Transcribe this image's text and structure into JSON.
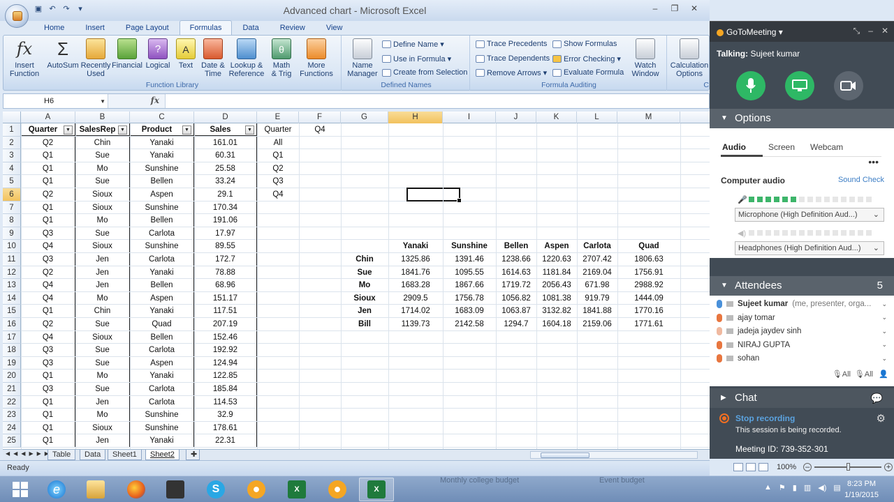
{
  "excel": {
    "title": "Advanced chart - Microsoft Excel",
    "tabs": [
      "Home",
      "Insert",
      "Page Layout",
      "Formulas",
      "Data",
      "Review",
      "View"
    ],
    "active_tab": "Formulas",
    "ribbon": {
      "function_library": {
        "label": "Function Library",
        "insert_function": "Insert\nFunction",
        "autosum": "AutoSum",
        "recently_used": "Recently\nUsed",
        "financial": "Financial",
        "logical": "Logical",
        "text": "Text",
        "date_time": "Date &\nTime",
        "lookup": "Lookup &\nReference",
        "math": "Math\n& Trig",
        "more": "More\nFunctions"
      },
      "defined_names": {
        "label": "Defined Names",
        "name_manager": "Name\nManager",
        "define_name": "Define Name",
        "use_in_formula": "Use in Formula",
        "create_from_selection": "Create from Selection"
      },
      "formula_auditing": {
        "label": "Formula Auditing",
        "trace_precedents": "Trace Precedents",
        "trace_dependents": "Trace Dependents",
        "remove_arrows": "Remove Arrows",
        "show_formulas": "Show Formulas",
        "error_checking": "Error Checking",
        "evaluate_formula": "Evaluate Formula",
        "watch_window": "Watch\nWindow"
      },
      "calculation": {
        "calc_options": "Calculation\nOptions",
        "label": "C"
      }
    },
    "name_box": "H6",
    "fx_symbol": "fx",
    "columns": [
      "A",
      "B",
      "C",
      "D",
      "E",
      "F",
      "G",
      "H",
      "I",
      "J",
      "K",
      "L",
      "M"
    ],
    "header_row": {
      "A": "Quarter",
      "B": "SalesRep",
      "C": "Product",
      "D": "Sales",
      "E": "Quarter",
      "F": "Q4"
    },
    "rows": [
      [
        "Q2",
        "Chin",
        "Yanaki",
        "161.01",
        "All"
      ],
      [
        "Q1",
        "Sue",
        "Yanaki",
        "60.31",
        "Q1"
      ],
      [
        "Q1",
        "Mo",
        "Sunshine",
        "25.58",
        "Q2"
      ],
      [
        "Q1",
        "Sue",
        "Bellen",
        "33.24",
        "Q3"
      ],
      [
        "Q2",
        "Sioux",
        "Aspen",
        "29.1",
        "Q4"
      ],
      [
        "Q1",
        "Sioux",
        "Sunshine",
        "170.34",
        ""
      ],
      [
        "Q1",
        "Mo",
        "Bellen",
        "191.06",
        ""
      ],
      [
        "Q3",
        "Sue",
        "Carlota",
        "17.97",
        ""
      ],
      [
        "Q4",
        "Sioux",
        "Sunshine",
        "89.55",
        ""
      ],
      [
        "Q3",
        "Jen",
        "Carlota",
        "172.7",
        ""
      ],
      [
        "Q2",
        "Jen",
        "Yanaki",
        "78.88",
        ""
      ],
      [
        "Q4",
        "Jen",
        "Bellen",
        "68.96",
        ""
      ],
      [
        "Q4",
        "Mo",
        "Aspen",
        "151.17",
        ""
      ],
      [
        "Q1",
        "Chin",
        "Yanaki",
        "117.51",
        ""
      ],
      [
        "Q2",
        "Sue",
        "Quad",
        "207.19",
        ""
      ],
      [
        "Q4",
        "Sioux",
        "Bellen",
        "152.46",
        ""
      ],
      [
        "Q3",
        "Sue",
        "Carlota",
        "192.92",
        ""
      ],
      [
        "Q3",
        "Sue",
        "Aspen",
        "124.94",
        ""
      ],
      [
        "Q1",
        "Mo",
        "Yanaki",
        "122.85",
        ""
      ],
      [
        "Q3",
        "Sue",
        "Carlota",
        "185.84",
        ""
      ],
      [
        "Q1",
        "Jen",
        "Carlota",
        "114.53",
        ""
      ],
      [
        "Q1",
        "Mo",
        "Sunshine",
        "32.9",
        ""
      ],
      [
        "Q1",
        "Sioux",
        "Sunshine",
        "178.61",
        ""
      ],
      [
        "Q1",
        "Jen",
        "Yanaki",
        "22.31",
        ""
      ]
    ],
    "pivot": {
      "products": [
        "Yanaki",
        "Sunshine",
        "Bellen",
        "Aspen",
        "Carlota",
        "Quad"
      ],
      "reps": [
        {
          "name": "Chin",
          "values": [
            "1325.86",
            "1391.46",
            "1238.66",
            "1220.63",
            "2707.42",
            "1806.63"
          ]
        },
        {
          "name": "Sue",
          "values": [
            "1841.76",
            "1095.55",
            "1614.63",
            "1181.84",
            "2169.04",
            "1756.91"
          ]
        },
        {
          "name": "Mo",
          "values": [
            "1683.28",
            "1867.66",
            "1719.72",
            "2056.43",
            "671.98",
            "2988.92"
          ]
        },
        {
          "name": "Sioux",
          "values": [
            "2909.5",
            "1756.78",
            "1056.82",
            "1081.38",
            "919.79",
            "1444.09"
          ]
        },
        {
          "name": "Jen",
          "values": [
            "1714.02",
            "1683.09",
            "1063.87",
            "3132.82",
            "1841.88",
            "1770.16"
          ]
        },
        {
          "name": "Bill",
          "values": [
            "1139.73",
            "2142.58",
            "1294.7",
            "1604.18",
            "2159.06",
            "1771.61"
          ]
        }
      ]
    },
    "sheet_tabs": [
      "Table",
      "Data",
      "Sheet1",
      "Sheet2"
    ],
    "active_sheet": "Sheet2",
    "status": "Ready",
    "zoom": "100%"
  },
  "gtm": {
    "title": "GoToMeeting",
    "talking_label": "Talking:",
    "talking_name": "Sujeet kumar",
    "options_label": "Options",
    "tabs": [
      "Audio",
      "Screen",
      "Webcam"
    ],
    "computer_audio": "Computer audio",
    "sound_check": "Sound Check",
    "mic_level_on": 6,
    "mic_level_total": 15,
    "microphone": "Microphone (High Definition Aud...)",
    "headphones": "Headphones (High Definition Aud...)",
    "attendees_label": "Attendees",
    "attendees_count": "5",
    "attendees": [
      {
        "name": "Sujeet kumar",
        "note": "(me, presenter, orga..."
      },
      {
        "name": "ajay tomar",
        "note": ""
      },
      {
        "name": "jadeja jaydev sinh",
        "note": ""
      },
      {
        "name": "NIRAJ GUPTA",
        "note": ""
      },
      {
        "name": "sohan",
        "note": ""
      }
    ],
    "mute_all_1": "All",
    "mute_all_2": "All",
    "chat_label": "Chat",
    "stop_recording": "Stop recording",
    "recording_note": "This session is being recorded.",
    "meeting_id": "Meeting ID: 739-352-301"
  },
  "taskbar": {
    "time": "8:23 PM",
    "date": "1/19/2015",
    "ghost_left": "Monthly college budget",
    "ghost_right": "Event budget"
  },
  "colors": {
    "accent_green": "#3db56a",
    "excel_blue": "#15428b",
    "gtm_dark": "#414b55",
    "record_orange": "#f26f21"
  }
}
